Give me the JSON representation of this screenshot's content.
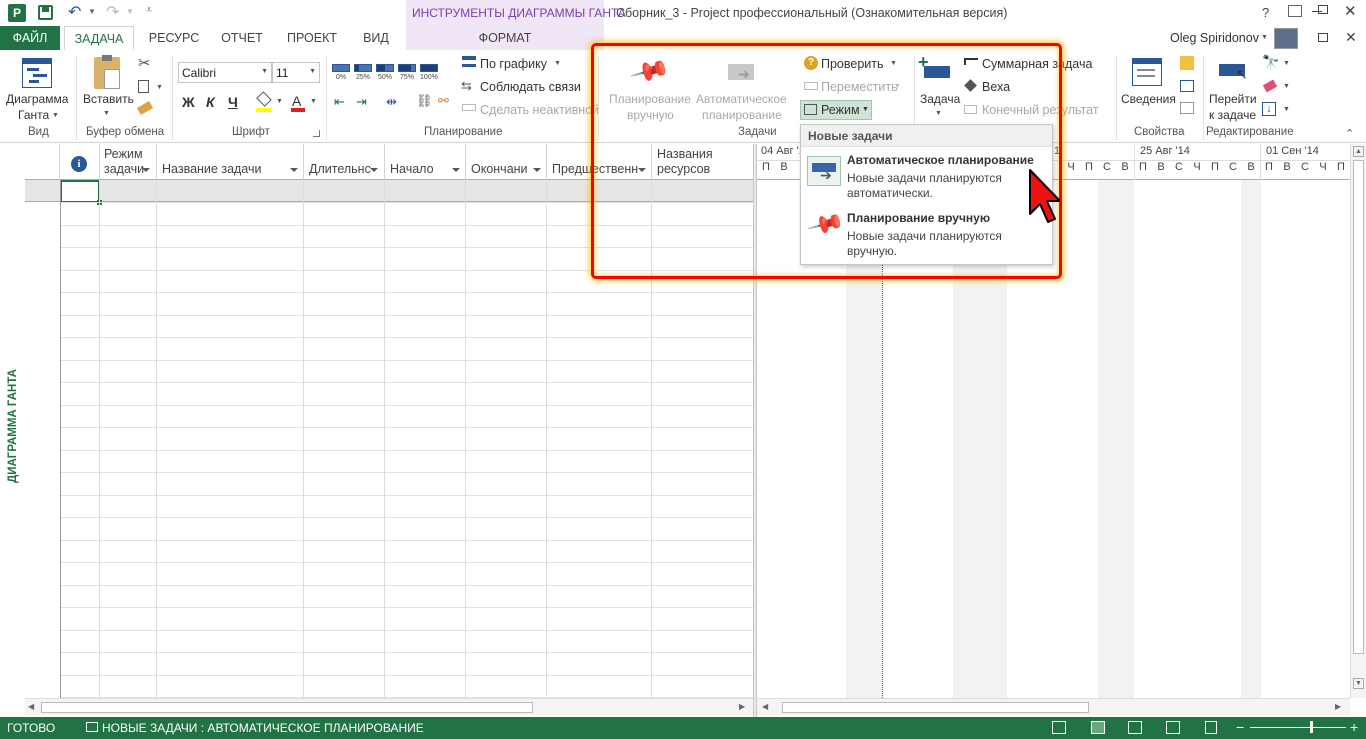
{
  "titlebar": {
    "context_tab": "ИНСТРУМЕНТЫ ДИАГРАММЫ ГАНТА",
    "title": "Сборник_3 - Project профессиональный (Ознакомительная версия)",
    "help": "?",
    "user": "Oleg Spiridonov"
  },
  "tabs": {
    "file": "ФАЙЛ",
    "task": "ЗАДАЧА",
    "resource": "РЕСУРС",
    "report": "ОТЧЕТ",
    "project": "ПРОЕКТ",
    "view": "ВИД",
    "format": "ФОРМАТ"
  },
  "ribbon": {
    "view": {
      "gantt_line1": "Диаграмма",
      "gantt_line2": "Ганта",
      "group": "Вид"
    },
    "clipboard": {
      "paste": "Вставить",
      "group": "Буфер обмена"
    },
    "font": {
      "name": "Calibri",
      "size": "11",
      "bold": "Ж",
      "italic": "К",
      "underline": "Ч",
      "group": "Шрифт"
    },
    "schedule": {
      "pct": [
        "0%",
        "25%",
        "50%",
        "75%",
        "100%"
      ],
      "on_track": "По графику",
      "respect_links": "Соблюдать связи",
      "inactivate": "Сделать неактивной",
      "group": "Планирование"
    },
    "tasks": {
      "manual_l1": "Планирование",
      "manual_l2": "вручную",
      "auto_l1": "Автоматическое",
      "auto_l2": "планирование",
      "inspect": "Проверить",
      "move": "Переместить",
      "mode": "Режим",
      "group": "Задачи"
    },
    "insert": {
      "task": "Задача",
      "summary": "Суммарная задача",
      "milestone": "Веха",
      "deliverable": "Конечный результат"
    },
    "properties": {
      "info": "Сведения",
      "group": "Свойства"
    },
    "editing": {
      "goto_l1": "Перейти",
      "goto_l2": "к задаче",
      "group": "Редактирование"
    }
  },
  "dropdown": {
    "header": "Новые задачи",
    "item1_title": "Автоматическое планирование",
    "item1_desc1": "Новые задачи планируются",
    "item1_desc2": "автоматически.",
    "item2_title": "Планирование вручную",
    "item2_desc1": "Новые задачи планируются",
    "item2_desc2": "вручную."
  },
  "grid": {
    "headers": {
      "mode_l1": "Режим",
      "mode_l2": "задачи",
      "name": "Название задачи",
      "duration": "Длительнс",
      "start": "Начало",
      "finish": "Окончани",
      "predecessors": "Предшественн",
      "resources_l1": "Названия",
      "resources_l2": "ресурсов"
    }
  },
  "timeline": {
    "week1": "04 Авг '14",
    "week_mid": "1",
    "week2": "25 Авг '14",
    "week3": "01 Сен '14",
    "days_left": [
      "П",
      "В"
    ],
    "days_mid": [
      "Ч",
      "П",
      "С",
      "В"
    ],
    "days_w2": [
      "П",
      "В",
      "С",
      "Ч",
      "П",
      "С",
      "В"
    ],
    "days_w3": [
      "П",
      "В",
      "С",
      "Ч",
      "П"
    ]
  },
  "side_label": "ДИАГРАММА ГАНТА",
  "status": {
    "ready": "ГОТОВО",
    "new_tasks": "НОВЫЕ ЗАДАЧИ : АВТОМАТИЧЕСКОЕ ПЛАНИРОВАНИЕ"
  },
  "colors": {
    "accent": "#217346",
    "context": "#7a3eb1",
    "highlight": "#ff0000"
  }
}
